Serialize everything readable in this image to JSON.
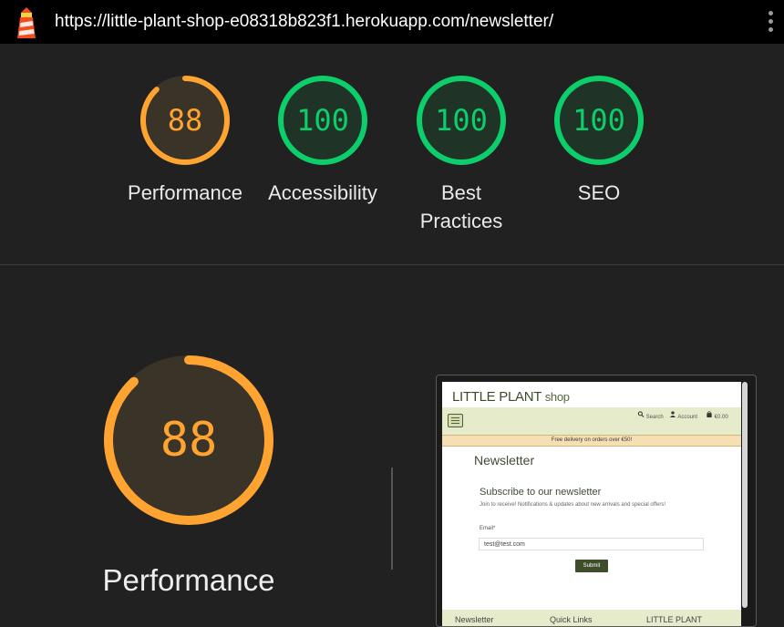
{
  "browser": {
    "url": "https://little-plant-shop-e08318b823f1.herokuapp.com/newsletter/"
  },
  "colors": {
    "average": "#ffa431",
    "pass": "#0cce6b"
  },
  "scores": [
    {
      "value": "88",
      "label": "Performance",
      "status": "average"
    },
    {
      "value": "100",
      "label": "Accessibility",
      "status": "pass"
    },
    {
      "value": "100",
      "label": "Best Practices",
      "status": "pass"
    },
    {
      "value": "100",
      "label": "SEO",
      "status": "pass"
    }
  ],
  "main_gauge": {
    "value": "88",
    "label": "Performance"
  },
  "screenshot": {
    "brand": "LITTLE PLANT",
    "brand_suffix": "shop",
    "nav": {
      "search": "Search",
      "account": "Account",
      "cart": "€0.00"
    },
    "banner": "Free delivery on orders over €50!",
    "title": "Newsletter",
    "subtitle": "Subscribe to our newsletter",
    "description": "Join to receive! Notifications & updates about new arrivals and special offers!",
    "email_label": "Email*",
    "email_value": "test@test.com",
    "submit": "Submit",
    "footer": [
      "Newsletter",
      "Quick Links",
      "LITTLE PLANT"
    ]
  }
}
